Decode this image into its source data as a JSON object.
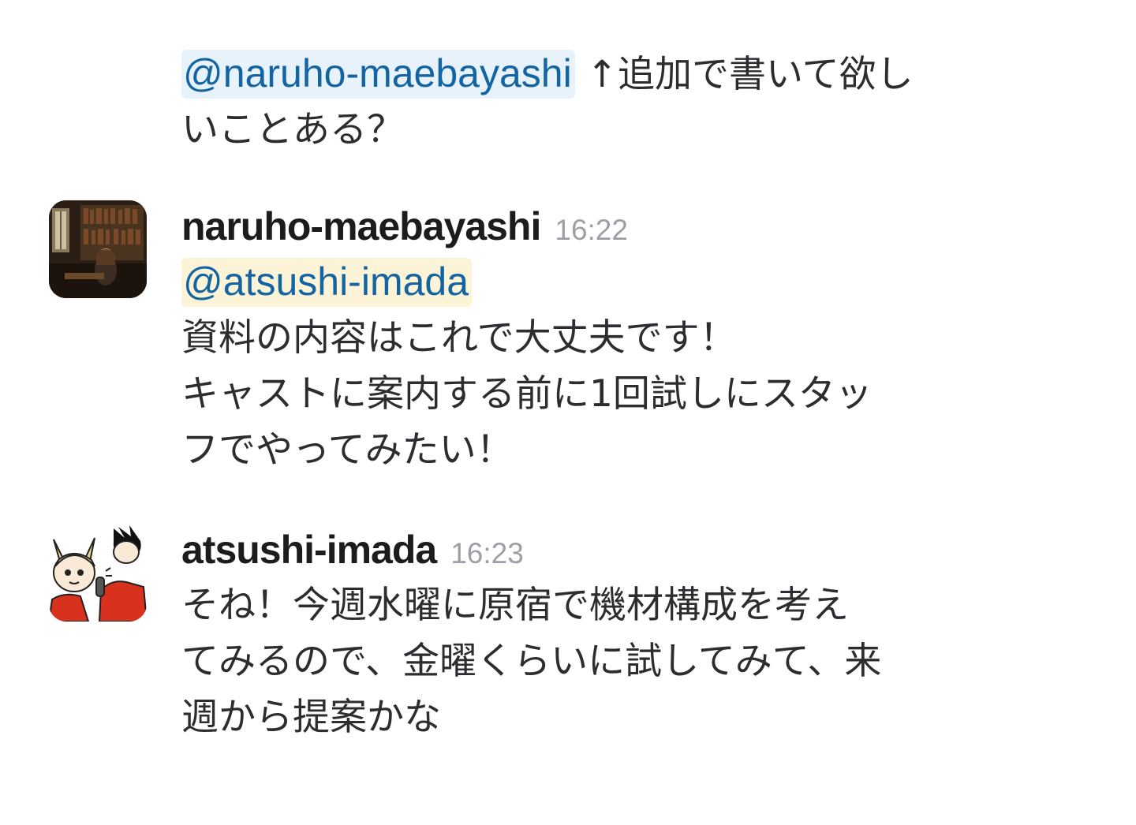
{
  "messages": [
    {
      "continuation": true,
      "mention": "@naruho-maebayashi",
      "line1_rest": " ↑追加で書いて欲し",
      "line2": "いことある？"
    },
    {
      "username": "naruho-maebayashi",
      "timestamp": "16:22",
      "avatar_icon": "library-photo-avatar",
      "mention": "@atsushi-imada",
      "lines": [
        "資料の内容はこれで大丈夫です！",
        "キャストに案内する前に1回試しにスタッ",
        "フでやってみたい！"
      ]
    },
    {
      "username": "atsushi-imada",
      "timestamp": "16:23",
      "avatar_icon": "anime-characters-avatar",
      "lines": [
        "そね！今週水曜に原宿で機材構成を考え",
        "てみるので、金曜くらいに試してみて、来",
        "週から提案かな"
      ]
    }
  ],
  "colors": {
    "mention_text": "#1264a3",
    "mention_bg_other": "#e8f2fb",
    "mention_bg_self": "#fdf3d6",
    "timestamp": "#9e9ea6"
  }
}
